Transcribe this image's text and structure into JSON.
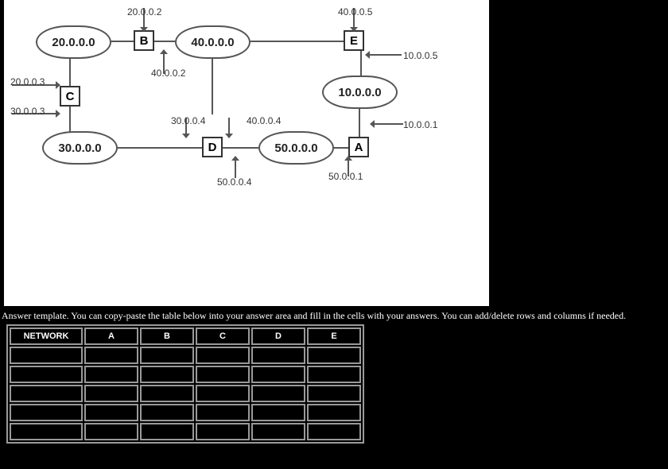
{
  "diagram": {
    "clouds": {
      "n20": "20.0.0.0",
      "n40": "40.0.0.0",
      "n10": "10.0.0.0",
      "n30": "30.0.0.0",
      "n50": "50.0.0.0"
    },
    "routers": {
      "a": "A",
      "b": "B",
      "c": "C",
      "d": "D",
      "e": "E"
    },
    "labels": {
      "b_top": "20.0.0.2",
      "e_top": "40.0.0.5",
      "b_bottom": "40.0.0.2",
      "c_top": "20.0.0.3",
      "c_bottom": "30.0.0.3",
      "d_left": "30.0.0.4",
      "d_top": "40.0.0.4",
      "d_bottom": "50.0.0.4",
      "a_bottom": "50.0.0.1",
      "a_top": "10.0.0.1",
      "e_right": "10.0.0.5"
    }
  },
  "instruction": "Answer template. You can copy-paste the table below into your answer area and fill in the cells with your answers. You can add/delete rows and columns if needed.",
  "table": {
    "headers": [
      "NETWORK",
      "A",
      "B",
      "C",
      "D",
      "E"
    ],
    "rows": 5
  }
}
